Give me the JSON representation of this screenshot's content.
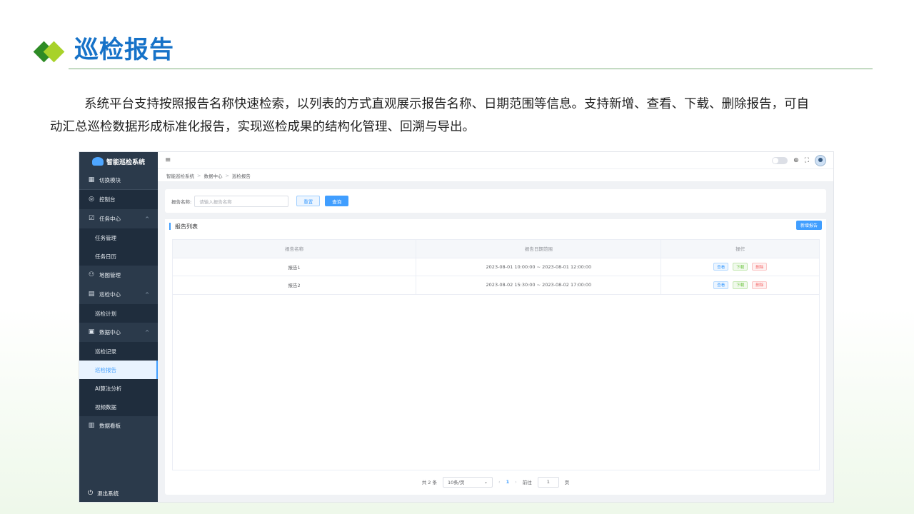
{
  "slide": {
    "title": "巡检报告",
    "intro_line1": "系统平台支持按照报告名称快速检索，以列表的方式直观展示报告名称、日期范围等信息。支持新增、查看、下载、删除报告，可自",
    "intro_line2": "动汇总巡检数据形成标准化报告，实现巡检成果的结构化管理、回溯与导出。"
  },
  "app": {
    "logo_text": "智能巡检系统",
    "sidebar": {
      "switch_module": "切换模块",
      "items": [
        {
          "label": "控制台"
        },
        {
          "label": "任务中心"
        },
        {
          "label": "任务管理"
        },
        {
          "label": "任务日历"
        },
        {
          "label": "地图管理"
        },
        {
          "label": "巡检中心"
        },
        {
          "label": "巡检计划"
        },
        {
          "label": "数据中心"
        },
        {
          "label": "巡检记录"
        },
        {
          "label": "巡检报告"
        },
        {
          "label": "AI算法分析"
        },
        {
          "label": "视频数据"
        },
        {
          "label": "数据看板"
        }
      ],
      "logout": "退出系统"
    },
    "breadcrumb": [
      "智能巡检系统",
      "数据中心",
      "巡检报告"
    ],
    "search": {
      "label": "报告名称:",
      "placeholder": "请输入报告名称",
      "reset": "重置",
      "query": "查询"
    },
    "list": {
      "title": "报告列表",
      "add_button": "新增报告",
      "columns": [
        "报告名称",
        "报告日期范围",
        "操作"
      ],
      "rows": [
        {
          "name": "报告1",
          "range": "2023-08-01 10:00:00 ~ 2023-08-01 12:00:00"
        },
        {
          "name": "报告2",
          "range": "2023-08-02 15:30:00 ~ 2023-08-02 17:00:00"
        }
      ],
      "actions": {
        "view": "查看",
        "download": "下载",
        "delete": "删除"
      }
    },
    "pager": {
      "total": "共 2 条",
      "page_size": "10条/页",
      "current_page": "1",
      "goto_label": "前往",
      "goto_value": "1",
      "page_suffix": "页"
    }
  }
}
